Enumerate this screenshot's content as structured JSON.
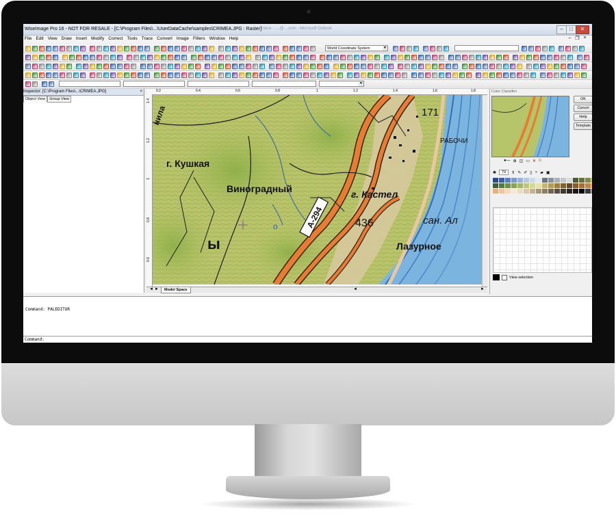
{
  "app": {
    "title": "WiseImage Pro 16 - NOT FOR RESALE - [C:\\Program Files\\...\\UserDataCache\\samples\\CRIMEA.JPG : Raster]",
    "background_window_title": "Inbox - ....@....com - Microsoft Outlook"
  },
  "window_controls": {
    "minimize": "–",
    "maximize": "□",
    "close": "✕"
  },
  "menu": {
    "items": [
      "File",
      "Edit",
      "View",
      "Draw",
      "Insert",
      "Modify",
      "Correct",
      "Tools",
      "Trace",
      "Convert",
      "Image",
      "Filters",
      "Window",
      "Help"
    ],
    "mdi": {
      "minimize": "–",
      "restore": "❐",
      "close": "×"
    }
  },
  "toolbar": {
    "coordinate_system": "World Coordinate System"
  },
  "inspector": {
    "title": "Inspector: [C:\\Program Files\\...\\CRIMEA.JPG]",
    "close": "×",
    "tabs": [
      "Object View",
      "Group View"
    ]
  },
  "rulers": {
    "top": [
      "0.2",
      "0.4",
      "0.6",
      "0.8",
      "1",
      "1.2",
      "1.4",
      "1.6",
      "1.8",
      "2"
    ],
    "left": [
      "1.4",
      "1.2",
      "1",
      "0.8",
      "0.6"
    ]
  },
  "map_labels": {
    "kushkaya": "г. Кушкая",
    "vinogradny": "Виноградный",
    "kastel": "г. Кастел",
    "road": "А-294",
    "elev_436": "436",
    "lazurnoe": "Лазурное",
    "sanal": "сан. Ал",
    "rabochi": "РАБОЧИ",
    "num_171": "171",
    "nila": "нила",
    "y": "ы",
    "o": "о"
  },
  "model_space_tab": "Model Space",
  "classifier": {
    "title": "Color Classifier",
    "buttons": [
      "OK",
      "Cancel",
      "Help",
      "Template"
    ],
    "colors_value": "79",
    "view_selection_label": "View selection",
    "palette": [
      "#2e4a86",
      "#3b5ea8",
      "#5a7fbf",
      "#7b9acb",
      "#9bb3d6",
      "#b7c8df",
      "#ced9e8",
      "#e3e9f1",
      "#6b7480",
      "#8a939d",
      "#a9b0b8",
      "#c4c8cc",
      "#dadcdd",
      "#4b5a3a",
      "#66713f",
      "#7f8b4a",
      "#9aa25b",
      "#3e5e3a",
      "#567a44",
      "#6f8f4b",
      "#88a358",
      "#a3b568",
      "#bcc77c",
      "#d3d893",
      "#e4e3ab",
      "#c9b46e",
      "#b49a52",
      "#9a7f3f",
      "#7d6432",
      "#5f4a26",
      "#8a5a2a",
      "#a86f33",
      "#c48544",
      "#d89c5c",
      "#e2b27a",
      "#ecc79b",
      "#f2dabb",
      "#f6e8d3",
      "#e9dcc4",
      "#d8c9ad",
      "#c2b394",
      "#a8987b",
      "#8d7f66",
      "#716553",
      "#574d40",
      "#3f3830",
      "#2a2521",
      "#1a1716",
      "#000000",
      "#3a3a3a",
      "#5d5d5d"
    ]
  },
  "command": {
    "history": "Command: PALEDITOR",
    "prompt": "Command:"
  }
}
